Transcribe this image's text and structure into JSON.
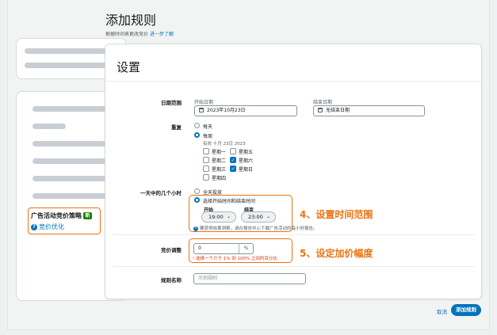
{
  "modal": {
    "title": "添加规则",
    "subtitle": "根据时间表更改竞价",
    "learn_more": "进一步了解"
  },
  "background": {
    "promo_title": "广告活动竞价策略",
    "promo_badge": "新",
    "promo_link": "竞价优化"
  },
  "settings": {
    "title": "设置",
    "date_range": {
      "label": "日期范围",
      "start_label": "开始日期",
      "start_value": "2023年10月23日",
      "end_label": "结束日期",
      "end_value": "无结束日期"
    },
    "repeat": {
      "label": "重复",
      "options": [
        "每天",
        "每周"
      ],
      "selected": "每周",
      "valid_until": "有效 十月 23日 2023",
      "days": [
        {
          "label": "星期一",
          "checked": false
        },
        {
          "label": "星期五",
          "checked": false
        },
        {
          "label": "星期二",
          "checked": false
        },
        {
          "label": "星期六",
          "checked": true
        },
        {
          "label": "星期三",
          "checked": false
        },
        {
          "label": "星期日",
          "checked": true
        },
        {
          "label": "星期四",
          "checked": false
        }
      ]
    },
    "hours": {
      "label": "一天中的几个小时",
      "options": [
        "全天投放",
        "选择开始时间和结束时间"
      ],
      "selected": "选择开始时间和结束时间",
      "start_label": "开始",
      "start_value": "19:00",
      "end_label": "结束",
      "end_value": "23:00",
      "hint": "要获得效果洞察，请在报告中心下载广告活动的每小时报告。"
    },
    "bid_adjustment": {
      "label": "竞价调整",
      "value": "0",
      "unit": "%",
      "error": "选择一个介于 1% 到 100% 之间的百分比"
    },
    "rule_name": {
      "label": "规则名称",
      "placeholder": "示例规则"
    }
  },
  "annotations": {
    "step4": "4、设置时间范围",
    "step5": "5、设定加价幅度"
  },
  "footer": {
    "cancel": "取消",
    "submit": "添加规则"
  },
  "colors": {
    "accent": "#0073bb",
    "highlight": "#ec7211",
    "error": "#d13212"
  }
}
